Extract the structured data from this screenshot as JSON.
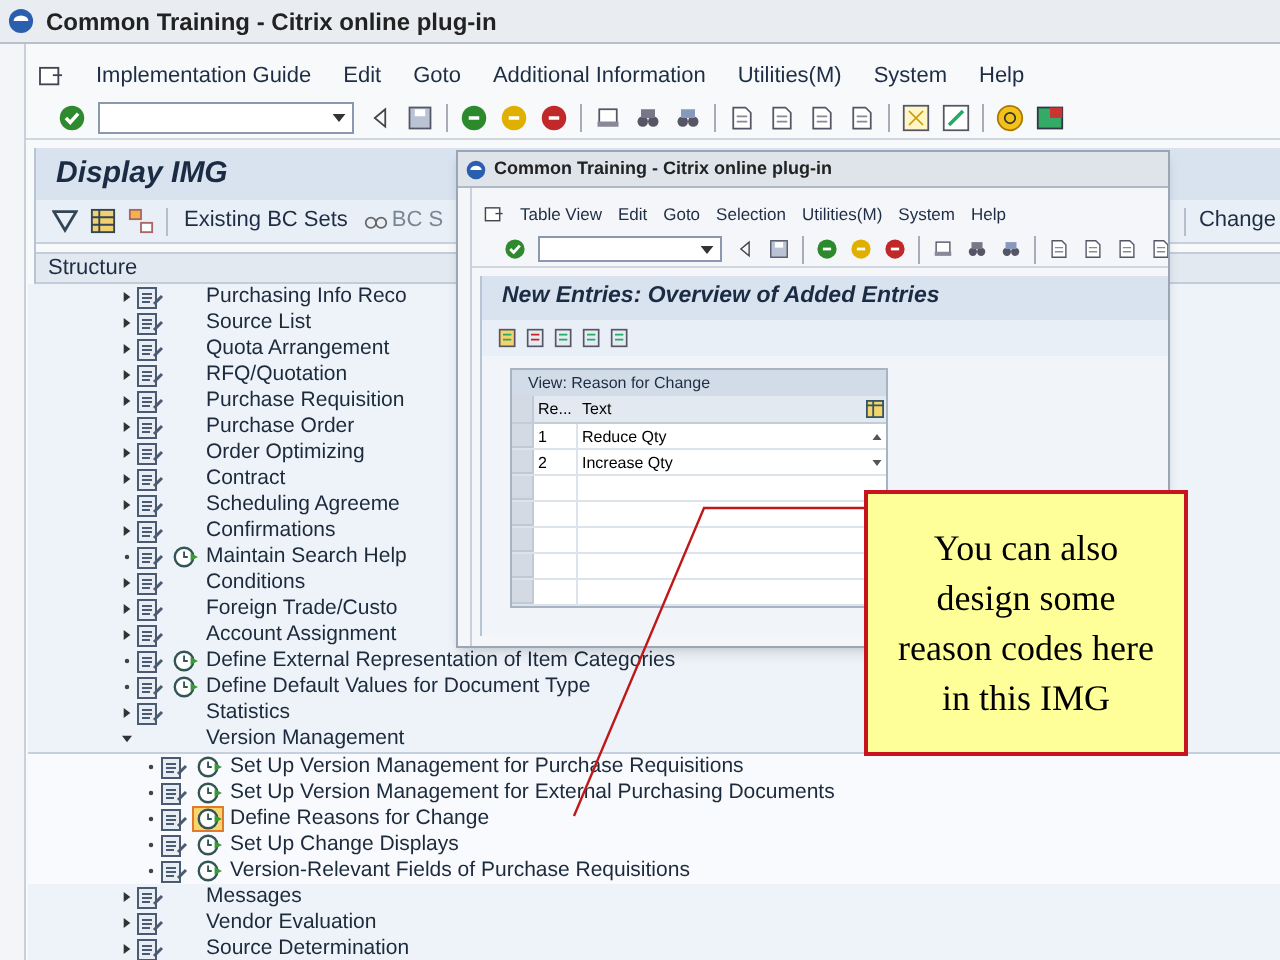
{
  "window": {
    "title": "Common Training - Citrix online plug-in"
  },
  "menu": [
    "Implementation Guide",
    "Edit",
    "Goto",
    "Additional Information",
    "Utilities(M)",
    "System",
    "Help"
  ],
  "screen_title": "Display IMG",
  "app_toolbar": {
    "buttons": [
      "Existing BC Sets",
      "BC S"
    ],
    "right_button": "Change"
  },
  "structure": {
    "header": "Structure",
    "items": [
      {
        "label": "Purchasing Info Reco",
        "kind": "folder",
        "expanded": false,
        "selected": false
      },
      {
        "label": "Source List",
        "kind": "folder",
        "expanded": false,
        "selected": false
      },
      {
        "label": "Quota Arrangement",
        "kind": "folder",
        "expanded": false,
        "selected": false
      },
      {
        "label": "RFQ/Quotation",
        "kind": "folder",
        "expanded": false,
        "selected": false
      },
      {
        "label": "Purchase Requisition",
        "kind": "folder",
        "expanded": false,
        "selected": false
      },
      {
        "label": "Purchase Order",
        "kind": "folder",
        "expanded": false,
        "selected": false
      },
      {
        "label": "Order Optimizing",
        "kind": "folder",
        "expanded": false,
        "selected": false
      },
      {
        "label": "Contract",
        "kind": "folder",
        "expanded": false,
        "selected": false
      },
      {
        "label": "Scheduling Agreeme",
        "kind": "folder",
        "expanded": false,
        "selected": false
      },
      {
        "label": "Confirmations",
        "kind": "folder",
        "expanded": false,
        "selected": false
      },
      {
        "label": "Maintain Search Help",
        "kind": "activity",
        "selected": false
      },
      {
        "label": "Conditions",
        "kind": "folder",
        "expanded": false,
        "selected": false
      },
      {
        "label": "Foreign Trade/Custo",
        "kind": "folder",
        "expanded": false,
        "selected": false
      },
      {
        "label": "Account Assignment",
        "kind": "folder",
        "expanded": false,
        "selected": false
      },
      {
        "label": "Define External Representation of Item Categories",
        "kind": "activity",
        "selected": false
      },
      {
        "label": "Define Default Values for Document Type",
        "kind": "activity",
        "selected": false
      },
      {
        "label": "Statistics",
        "kind": "folder",
        "expanded": false,
        "selected": false
      },
      {
        "label": "Version Management",
        "kind": "folder",
        "expanded": true,
        "selected": false,
        "children": [
          {
            "label": "Set Up Version Management for Purchase Requisitions",
            "kind": "activity",
            "selected": false
          },
          {
            "label": "Set Up Version Management for External Purchasing Documents",
            "kind": "activity",
            "selected": false
          },
          {
            "label": "Define Reasons for Change",
            "kind": "activity",
            "selected": true
          },
          {
            "label": "Set Up Change Displays",
            "kind": "activity",
            "selected": false
          },
          {
            "label": "Version-Relevant Fields of Purchase Requisitions",
            "kind": "activity",
            "selected": false
          }
        ]
      },
      {
        "label": "Messages",
        "kind": "folder",
        "expanded": false,
        "selected": false
      },
      {
        "label": "Vendor Evaluation",
        "kind": "folder",
        "expanded": false,
        "selected": false
      },
      {
        "label": "Source Determination",
        "kind": "folder",
        "expanded": false,
        "selected": false
      }
    ]
  },
  "dialog": {
    "title": "Common Training - Citrix online plug-in",
    "menu": [
      "Table View",
      "Edit",
      "Goto",
      "Selection",
      "Utilities(M)",
      "System",
      "Help"
    ],
    "screen_title": "New Entries: Overview of Added Entries",
    "table": {
      "title": "View: Reason for Change",
      "columns": [
        "Re...",
        "Text"
      ],
      "rows": [
        {
          "code": "1",
          "text": "Reduce Qty"
        },
        {
          "code": "2",
          "text": "Increase Qty"
        }
      ]
    }
  },
  "callout": {
    "text": "You can also design some reason codes here in this IMG"
  }
}
